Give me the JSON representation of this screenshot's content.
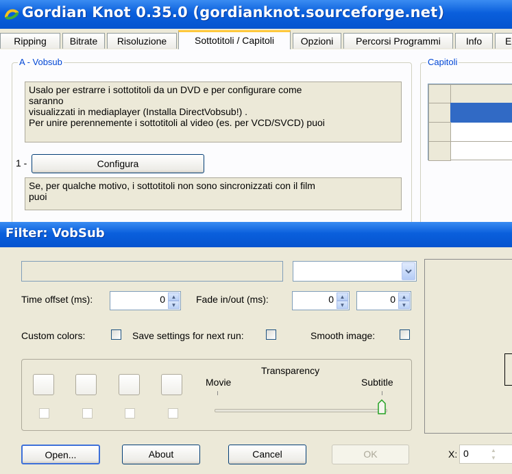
{
  "gk_window": {
    "title": "Gordian Knot 0.35.0  (gordianknot.sourceforge.net)",
    "tabs": [
      "Ripping",
      "Bitrate",
      "Risoluzione",
      "Sottotitoli / Capitoli",
      "Opzioni",
      "Percorsi Programmi",
      "Info",
      "E"
    ],
    "active_tab_index": 3,
    "vobsub_group": {
      "legend": "A - Vobsub",
      "note1_lines": [
        "Usalo per estrarre i sottotitoli da un DVD e per configurare come",
        "saranno",
        "visualizzati in mediaplayer (Installa DirectVobsub!) .",
        "Per unire perennemente i sottotitoli al video (es. per VCD/SVCD) puoi"
      ],
      "step1_label": "1 -",
      "configure_button": "Configura",
      "note2_lines": [
        "Se, per qualche motivo, i sottotitoli non sono sincronizzati con il film",
        "puoi"
      ]
    },
    "capitoli_group": {
      "legend": "Capitoli"
    }
  },
  "vobsub_dialog": {
    "title": "Filter: VobSub",
    "time_offset_label": "Time offset (ms):",
    "time_offset_value": "0",
    "fade_label": "Fade in/out (ms):",
    "fade_in_value": "0",
    "fade_out_value": "0",
    "custom_colors_label": "Custom colors:",
    "save_settings_label": "Save settings for next run:",
    "smooth_image_label": "Smooth image:",
    "transparency_label": "Transparency",
    "movie_label": "Movie",
    "subtitle_label": "Subtitle",
    "transparency_level": 1.0,
    "buttons": {
      "open": "Open...",
      "about": "About",
      "cancel": "Cancel",
      "ok": "OK"
    },
    "x_label": "X:",
    "x_value": "0"
  },
  "colors": {
    "titlebar": "#0a5fdc",
    "face": "#ece9d8",
    "selected_row": "#316ac5",
    "tab_highlight": "#ffc83c",
    "legend_text": "#0046d5"
  }
}
